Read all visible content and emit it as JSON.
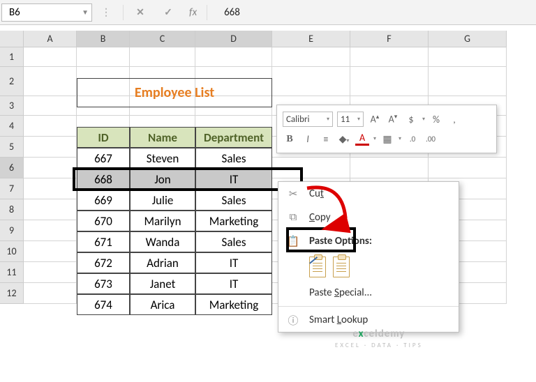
{
  "namebox": {
    "ref": "B6",
    "formula_value": "668",
    "fx_label": "fx"
  },
  "icons": {
    "cancel": "✕",
    "enter": "✓",
    "dots": "⋮"
  },
  "columns": [
    "A",
    "B",
    "C",
    "D",
    "E",
    "F",
    "G"
  ],
  "rows": [
    "1",
    "2",
    "3",
    "4",
    "5",
    "6",
    "7",
    "8",
    "9",
    "10",
    "11",
    "12"
  ],
  "title": "Employee List",
  "table": {
    "headers": {
      "id": "ID",
      "name": "Name",
      "dept": "Department"
    },
    "rows": [
      {
        "id": "667",
        "name": "Steven",
        "dept": "Sales"
      },
      {
        "id": "668",
        "name": "Jon",
        "dept": "IT"
      },
      {
        "id": "669",
        "name": "Julie",
        "dept": "Sales"
      },
      {
        "id": "670",
        "name": "Marilyn",
        "dept": "Marketing"
      },
      {
        "id": "671",
        "name": "Wanda",
        "dept": "Sales"
      },
      {
        "id": "672",
        "name": "Adrian",
        "dept": "IT"
      },
      {
        "id": "673",
        "name": "Janet",
        "dept": "IT"
      },
      {
        "id": "674",
        "name": "Arica",
        "dept": "Marketing"
      }
    ],
    "selected_index": 1
  },
  "mini_toolbar": {
    "font": "Calibri",
    "size": "11",
    "buttons": {
      "incfont": "A",
      "decfont": "A",
      "dollar": "$",
      "percent": "%",
      "bold": "B",
      "italic": "I",
      "comma": ",",
      "incd": ".0",
      "decd": ".00"
    }
  },
  "ctx": {
    "cut": "Cut",
    "copy": "Copy",
    "paste_options": "Paste Options:",
    "paste_special": "Paste Special...",
    "smart_lookup": "Smart Lookup"
  },
  "watermark": {
    "brand_pre": "e",
    "brand_x": "x",
    "brand_post": "celdemy",
    "sub": "EXCEL · DATA · TIPS"
  }
}
